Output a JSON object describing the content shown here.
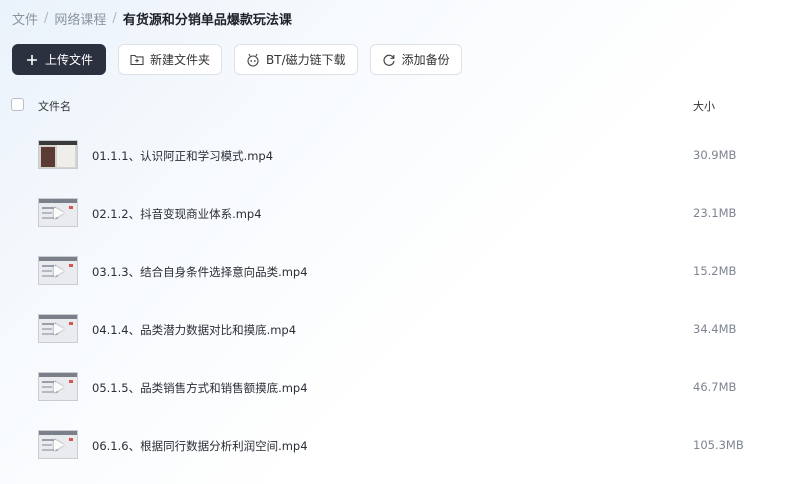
{
  "breadcrumb": {
    "root": "文件",
    "parent": "网络课程",
    "current": "有货源和分销单品爆款玩法课",
    "separator": "/"
  },
  "toolbar": {
    "upload_label": "上传文件",
    "new_folder_label": "新建文件夹",
    "bt_label": "BT/磁力链下载",
    "backup_label": "添加备份"
  },
  "table": {
    "col_name": "文件名",
    "col_size": "大小"
  },
  "files": [
    {
      "name": "01.1.1、认识阿正和学习模式.mp4",
      "size": "30.9MB"
    },
    {
      "name": "02.1.2、抖音变现商业体系.mp4",
      "size": "23.1MB"
    },
    {
      "name": "03.1.3、结合自身条件选择意向品类.mp4",
      "size": "15.2MB"
    },
    {
      "name": "04.1.4、品类潜力数据对比和摸底.mp4",
      "size": "34.4MB"
    },
    {
      "name": "05.1.5、品类销售方式和销售额摸底.mp4",
      "size": "46.7MB"
    },
    {
      "name": "06.1.6、根据同行数据分析利润空间.mp4",
      "size": "105.3MB"
    }
  ],
  "colors": {
    "primary_button": "#2c3140",
    "text_muted": "#8b93a1"
  }
}
